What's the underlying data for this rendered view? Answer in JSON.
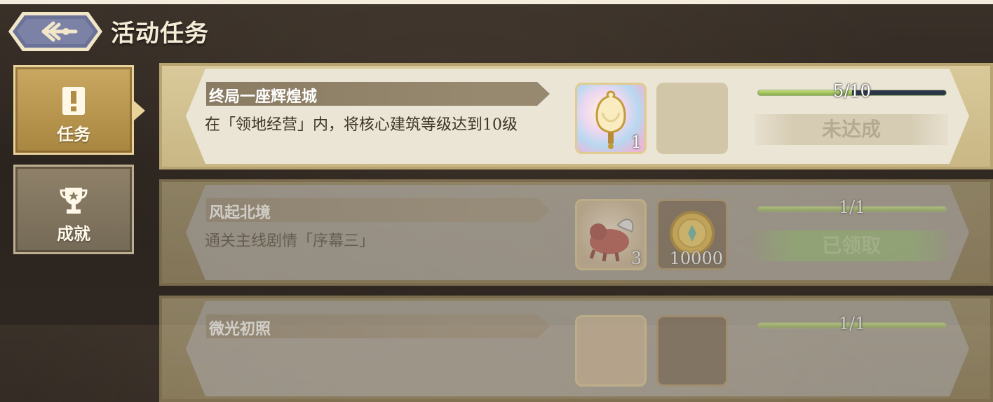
{
  "header": {
    "title": "活动任务",
    "back_icon": "back-arrow-icon"
  },
  "sidebar": {
    "tabs": [
      {
        "label": "任务",
        "icon": "exclamation-icon",
        "selected": true
      },
      {
        "label": "成就",
        "icon": "trophy-icon",
        "selected": false
      }
    ]
  },
  "tasks": [
    {
      "title": "终局一座辉煌城",
      "description": "在「领地经营」内，将核心建筑等级达到10级",
      "rewards": [
        {
          "icon": "bell-lantern-icon",
          "count": "1"
        },
        {
          "icon": "empty-slot",
          "count": ""
        }
      ],
      "progress_text": "5/10",
      "progress": 0.5,
      "status": "未达成"
    },
    {
      "title": "风起北境",
      "description": "通关主线剧情「序幕三」",
      "rewards": [
        {
          "icon": "red-beast-icon",
          "count": "3"
        },
        {
          "icon": "gold-coin-icon",
          "count": "10000"
        }
      ],
      "progress_text": "1/1",
      "progress": 1.0,
      "status": "已领取"
    },
    {
      "title": "微光初照",
      "progress_text": "1/1",
      "progress": 1.0
    }
  ],
  "colors": {
    "accent_gold": "#caa862",
    "progress_green": "#a6c864",
    "claimed_green": "#8cb06a"
  }
}
